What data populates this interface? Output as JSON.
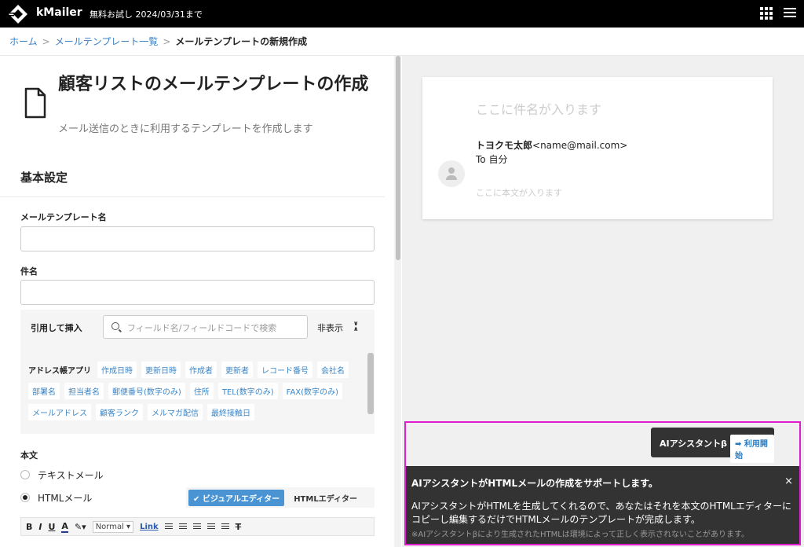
{
  "topbar": {
    "app_name": "kMailer",
    "trial": "無料お試し 2024/03/31まで",
    "logo_icon": "kmailer-logo-icon",
    "apps_icon": "grid-icon",
    "menu_icon": "hamburger-icon"
  },
  "breadcrumb": {
    "home": "ホーム",
    "list": "メールテンプレート一覧",
    "current": "メールテンプレートの新規作成",
    "separator": ">"
  },
  "header": {
    "title": "顧客リストのメールテンプレートの作成",
    "subtitle": "メール送信のときに利用するテンプレートを作成します"
  },
  "form": {
    "section_title": "基本設定",
    "template_name_label": "メールテンプレート名",
    "template_name_value": "",
    "subject_label": "件名",
    "subject_value": "",
    "quote_label": "引用して挿入",
    "quote_placeholder": "フィールド名/フィールドコードで検索",
    "hide_label": "非表示",
    "field_group": "アドレス帳アプリ",
    "fields": [
      "作成日時",
      "更新日時",
      "作成者",
      "更新者",
      "レコード番号",
      "会社名",
      "部署名",
      "担当者名",
      "郵便番号(数字のみ)",
      "住所",
      "TEL(数字のみ)",
      "FAX(数字のみ)",
      "メールアドレス",
      "顧客ランク",
      "メルマガ配信",
      "最終接触日"
    ],
    "body_label": "本文",
    "radio_text": "テキストメール",
    "radio_html": "HTMLメール",
    "selected_format": "HTMLメール",
    "tab_visual": "ビジュアルエディター",
    "tab_html": "HTMLエディター",
    "toolbar": {
      "bold": "B",
      "italic": "I",
      "underline": "U",
      "font_color": "A",
      "format_select": "Normal",
      "link": "Link",
      "clear": "T"
    }
  },
  "preview": {
    "subject_placeholder": "ここに件名が入ります",
    "sender_name": "トヨクモ太郎",
    "sender_email": "<name@mail.com>",
    "to_line": "To 自分",
    "body_placeholder": "ここに本文が入ります"
  },
  "ai": {
    "button_label": "AIアシスタントβ",
    "start_label": "利用開始",
    "panel_title": "AIアシスタントがHTMLメールの作成をサポートします。",
    "close": "×",
    "panel_body": "AIアシスタントがHTMLを生成してくれるので、あなたはそれを本文のHTMLエディターにコピーし編集するだけでHTMLメールのテンプレートが完成します。",
    "panel_note": "※AIアシスタントβにより生成されたHTMLは環境によって正しく表示されないことがあります。"
  },
  "colors": {
    "topbar": "#000000",
    "link": "#3a7fc4",
    "accent_blue": "#4a94d4",
    "highlight_border": "#e01ed0",
    "ai_panel": "#333333"
  }
}
